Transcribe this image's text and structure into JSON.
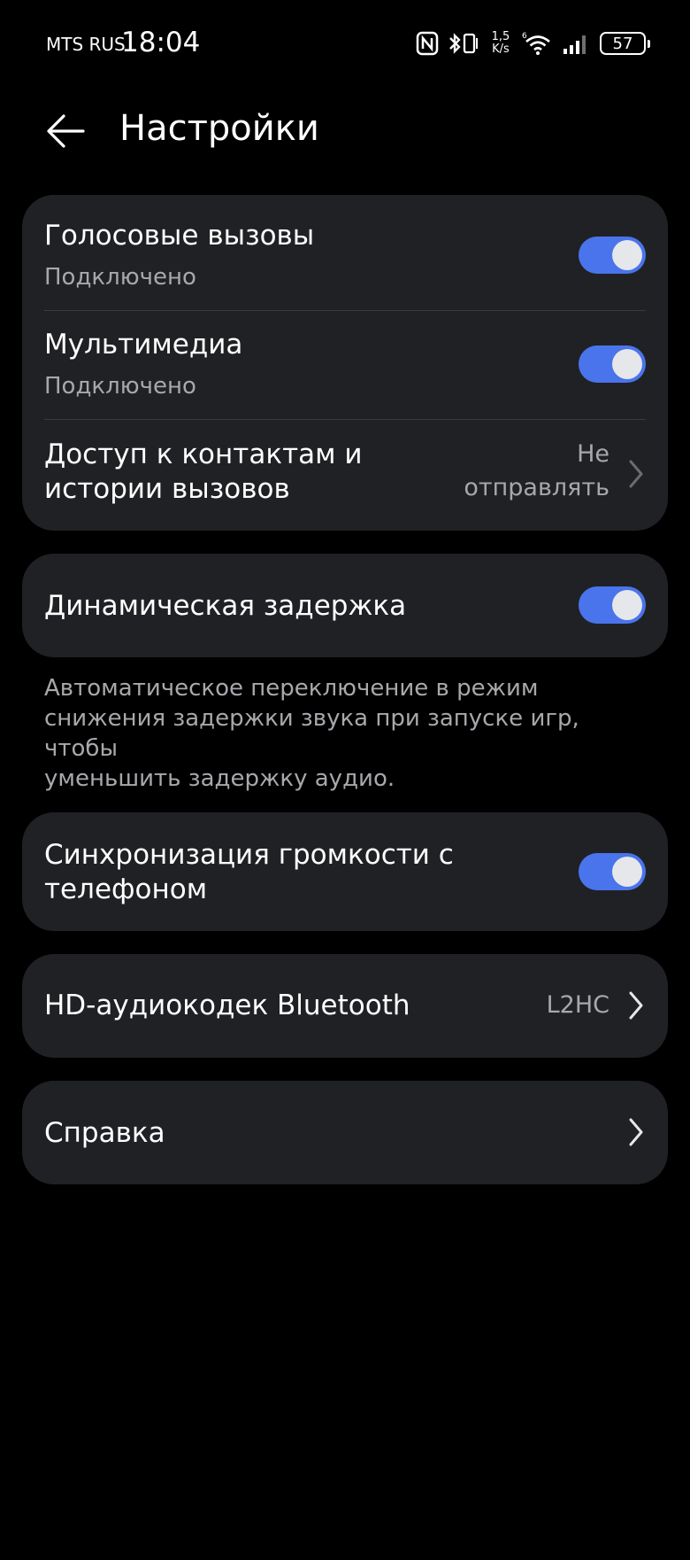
{
  "status_bar": {
    "carrier": "MTS RUS",
    "time": "18:04",
    "net_speed_value": "1,5",
    "net_speed_unit": "K/s",
    "wifi_label": "6",
    "battery": "57",
    "icons": [
      "nfc-icon",
      "bluetooth-vibrate-icon",
      "wifi-icon",
      "signal-icon",
      "battery-icon"
    ]
  },
  "header": {
    "title": "Настройки"
  },
  "connections": {
    "voice_calls": {
      "title": "Голосовые вызовы",
      "status": "Подключено",
      "enabled": true
    },
    "multimedia": {
      "title": "Мультимедиа",
      "status": "Подключено",
      "enabled": true
    },
    "contacts_access": {
      "title_line1": "Доступ к контактам и",
      "title_line2": "истории вызовов",
      "value_line1": "Не",
      "value_line2": "отправлять"
    }
  },
  "dynamic_latency": {
    "title": "Динамическая задержка",
    "enabled": true,
    "description_line1": "Автоматическое переключение в режим",
    "description_line2": "снижения задержки звука при запуске игр, чтобы",
    "description_line3": "уменьшить задержку аудио."
  },
  "volume_sync": {
    "title_line1": "Синхронизация громкости с",
    "title_line2": "телефоном",
    "enabled": true
  },
  "hd_codec": {
    "title": "HD-аудиокодек Bluetooth",
    "value": "L2HC"
  },
  "help": {
    "title": "Справка"
  },
  "colors": {
    "background": "#000000",
    "card": "#202124",
    "accent": "#4a74ec",
    "secondary_text": "#a7a8ac"
  }
}
